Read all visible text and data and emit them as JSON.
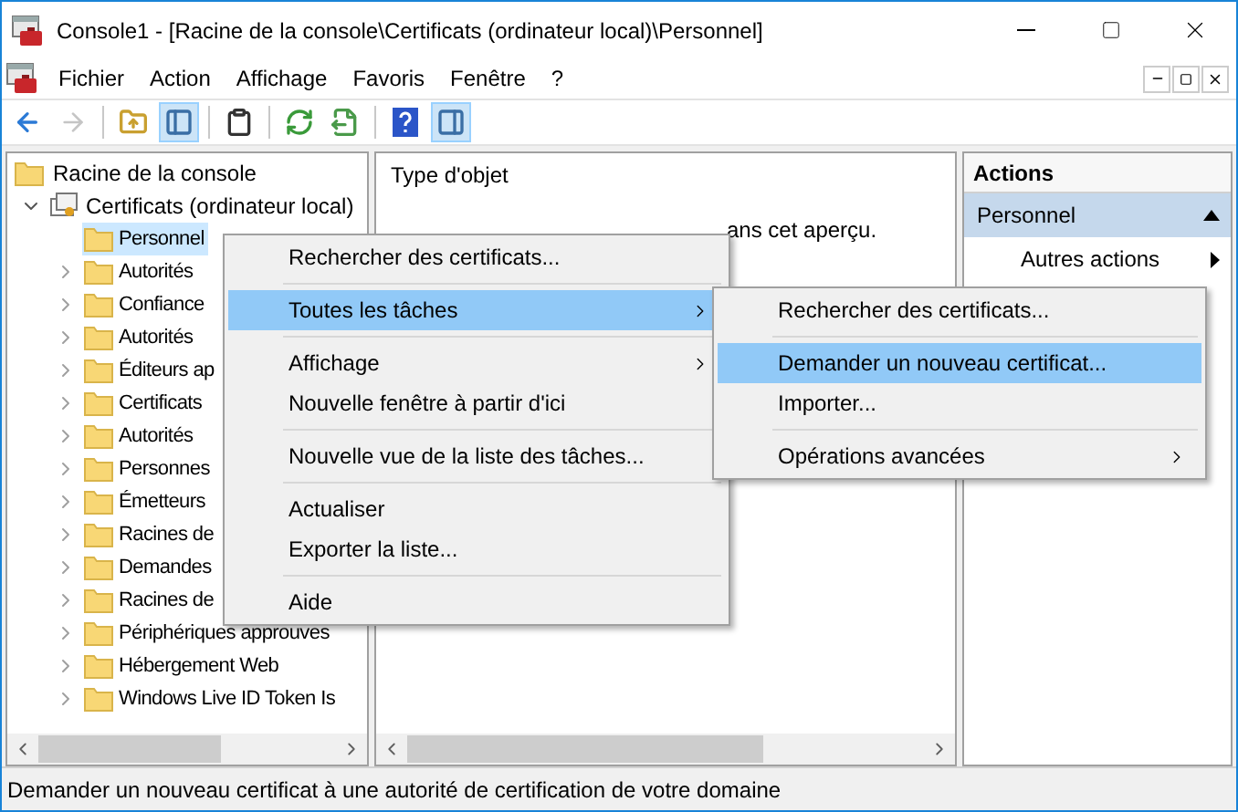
{
  "window": {
    "title": "Console1 - [Racine de la console\\Certificats (ordinateur local)\\Personnel]"
  },
  "menu_bar": [
    "Fichier",
    "Action",
    "Affichage",
    "Favoris",
    "Fenêtre",
    "?"
  ],
  "toolbar": [
    {
      "kind": "button",
      "pressed": false,
      "disabled": false
    },
    {
      "kind": "button",
      "pressed": false,
      "disabled": true
    },
    {
      "kind": "separator"
    },
    {
      "kind": "button",
      "pressed": false,
      "disabled": false
    },
    {
      "kind": "button",
      "pressed": true,
      "disabled": false
    },
    {
      "kind": "separator"
    },
    {
      "kind": "button",
      "pressed": false,
      "disabled": false
    },
    {
      "kind": "separator"
    },
    {
      "kind": "button",
      "pressed": false,
      "disabled": false
    },
    {
      "kind": "button",
      "pressed": false,
      "disabled": false
    },
    {
      "kind": "separator"
    },
    {
      "kind": "button",
      "pressed": false,
      "disabled": false
    },
    {
      "kind": "button",
      "pressed": true,
      "disabled": false
    }
  ],
  "tree": {
    "root": "Racine de la console",
    "node": {
      "label": "Certificats (ordinateur local)",
      "expanded": true,
      "children": [
        {
          "label": "Personnel",
          "selected": true,
          "has_children": false
        },
        {
          "label": "Autorités",
          "selected": false,
          "has_children": true
        },
        {
          "label": "Confiance",
          "selected": false,
          "has_children": true
        },
        {
          "label": "Autorités",
          "selected": false,
          "has_children": true
        },
        {
          "label": "Éditeurs ap",
          "selected": false,
          "has_children": true
        },
        {
          "label": "Certificats",
          "selected": false,
          "has_children": true
        },
        {
          "label": "Autorités",
          "selected": false,
          "has_children": true
        },
        {
          "label": "Personnes",
          "selected": false,
          "has_children": true
        },
        {
          "label": "Émetteurs",
          "selected": false,
          "has_children": true
        },
        {
          "label": "Racines de",
          "selected": false,
          "has_children": true
        },
        {
          "label": "Demandes",
          "selected": false,
          "has_children": true
        },
        {
          "label": "Racines de",
          "selected": false,
          "has_children": true
        },
        {
          "label": "Périphériques approuves",
          "selected": false,
          "has_children": true
        },
        {
          "label": "Hébergement Web",
          "selected": false,
          "has_children": true
        },
        {
          "label": "Windows Live ID Token Is",
          "selected": false,
          "has_children": true
        }
      ]
    }
  },
  "list_view": {
    "column": "Type d'objet",
    "message": "ans cet aperçu."
  },
  "actions_pane": {
    "title": "Actions",
    "section": {
      "label": "Personnel",
      "expanded": true
    },
    "items": [
      {
        "label": "Autres actions",
        "has_submenu": true
      }
    ]
  },
  "context_menu": [
    {
      "kind": "item",
      "label": "Rechercher des certificats...",
      "selected": false,
      "has_submenu": false
    },
    {
      "kind": "separator"
    },
    {
      "kind": "item",
      "label": "Toutes les tâches",
      "selected": true,
      "has_submenu": true
    },
    {
      "kind": "separator"
    },
    {
      "kind": "item",
      "label": "Affichage",
      "selected": false,
      "has_submenu": true
    },
    {
      "kind": "item",
      "label": "Nouvelle fenêtre à partir d'ici",
      "selected": false,
      "has_submenu": false
    },
    {
      "kind": "separator"
    },
    {
      "kind": "item",
      "label": "Nouvelle vue de la liste des tâches...",
      "selected": false,
      "has_submenu": false
    },
    {
      "kind": "separator"
    },
    {
      "kind": "item",
      "label": "Actualiser",
      "selected": false,
      "has_submenu": false
    },
    {
      "kind": "item",
      "label": "Exporter la liste...",
      "selected": false,
      "has_submenu": false
    },
    {
      "kind": "separator"
    },
    {
      "kind": "item",
      "label": "Aide",
      "selected": false,
      "has_submenu": false
    }
  ],
  "submenu": [
    {
      "kind": "item",
      "label": "Rechercher des certificats...",
      "selected": false,
      "has_submenu": false
    },
    {
      "kind": "separator"
    },
    {
      "kind": "item",
      "label": "Demander un nouveau certificat...",
      "selected": true,
      "has_submenu": false
    },
    {
      "kind": "item",
      "label": "Importer...",
      "selected": false,
      "has_submenu": false
    },
    {
      "kind": "separator"
    },
    {
      "kind": "item",
      "label": "Opérations avancées",
      "selected": false,
      "has_submenu": true
    }
  ],
  "status_bar": "Demander un nouveau certificat à une autorité de certification de votre domaine"
}
